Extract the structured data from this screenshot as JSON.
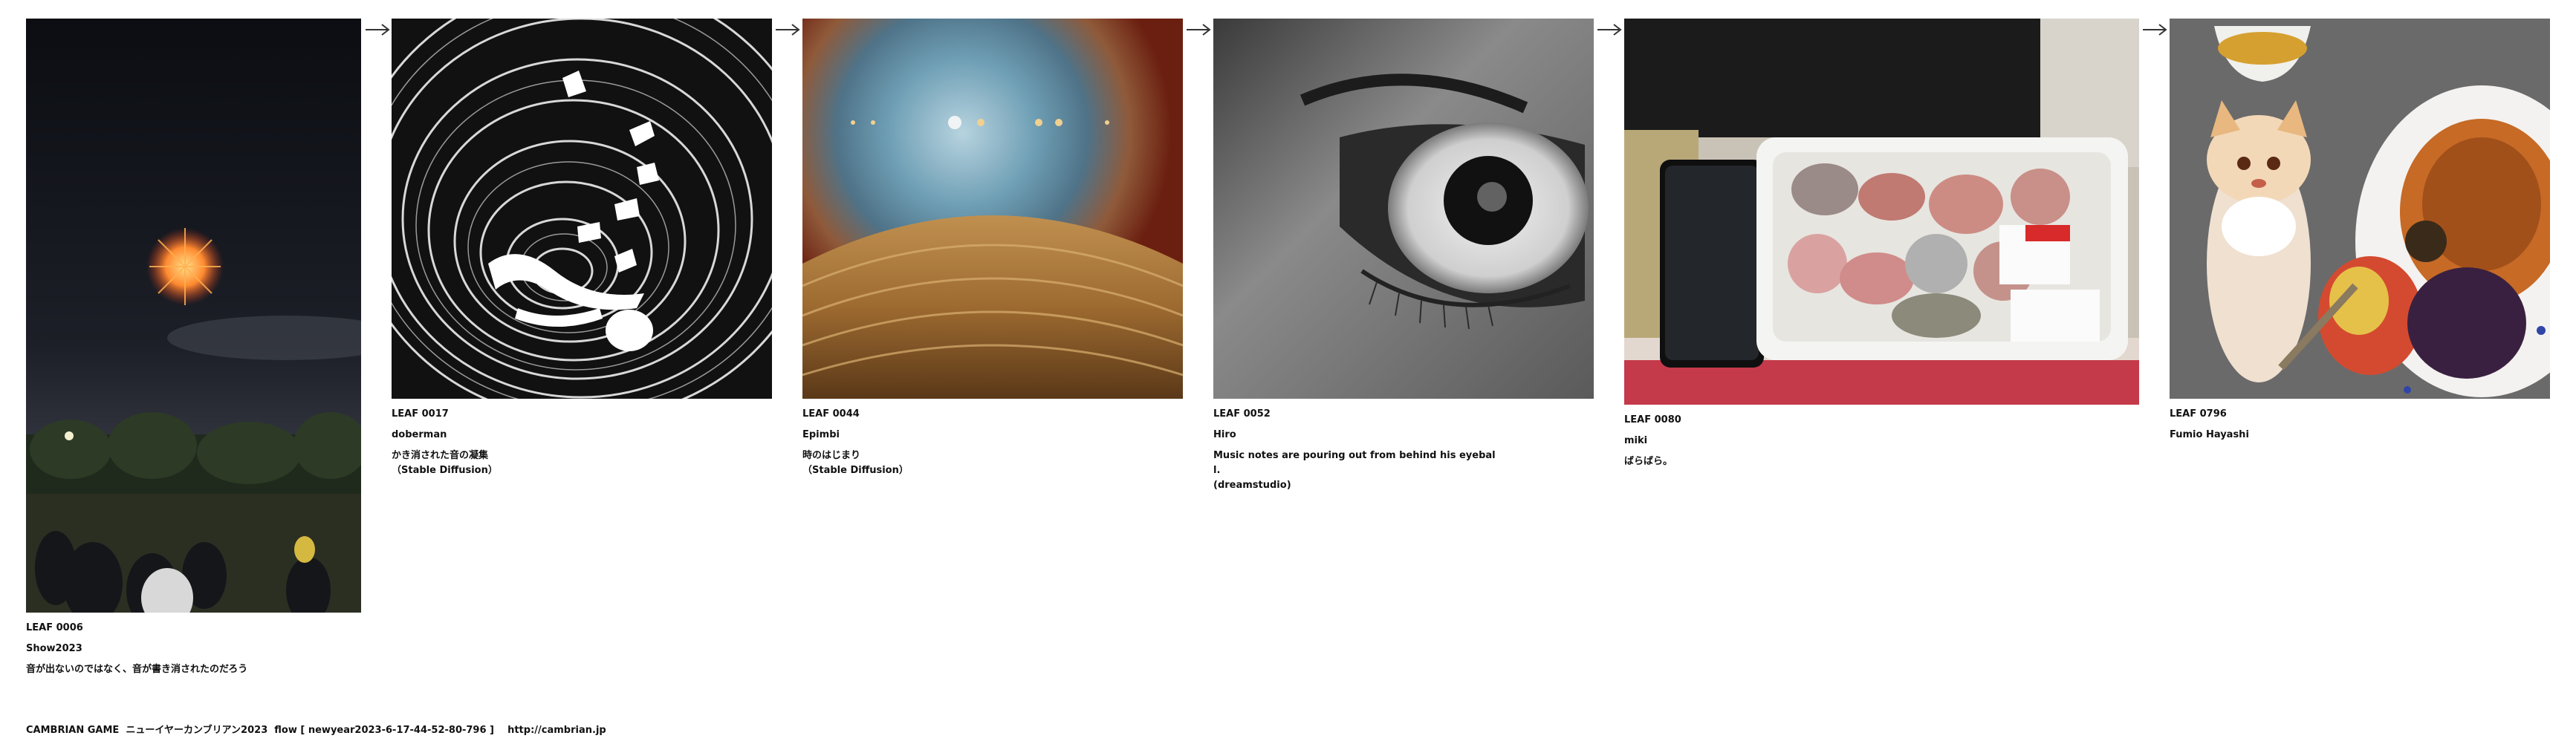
{
  "flow": [
    {
      "leaf": "LEAF 0006",
      "author": "Show2023",
      "title": "音が出ないのではなく、音が書き消されたのだろう",
      "image": "fireworks-over-park-night-crowd"
    },
    {
      "leaf": "LEAF 0017",
      "author": "doberman",
      "title": "かき消された音の凝集\n（Stable Diffusion）",
      "image": "abstract-swirl-black-white"
    },
    {
      "leaf": "LEAF 0044",
      "author": "Epimbi",
      "title": "時のはじまり\n（Stable Diffusion）",
      "image": "cosmic-eye-landscape"
    },
    {
      "leaf": "LEAF 0052",
      "author": "Hiro",
      "title": "Music notes are pouring out from behind his eyebal\nl.\n(dreamstudio)",
      "image": "eye-closeup-grayscale"
    },
    {
      "leaf": "LEAF 0080",
      "author": "miki",
      "title": "ばらばら。",
      "image": "fish-pieces-in-tray"
    },
    {
      "leaf": "LEAF 0796",
      "author": "Fumio Hayashi",
      "title": "",
      "image": "figurine-with-fruit-plate"
    }
  ],
  "footer": {
    "text": "CAMBRIAN GAME  ニューイヤーカンブリアン2023  flow [ newyear2023-6-17-44-52-80-796 ]    http://cambrian.jp"
  },
  "arrow_icon": "right-arrow-icon"
}
